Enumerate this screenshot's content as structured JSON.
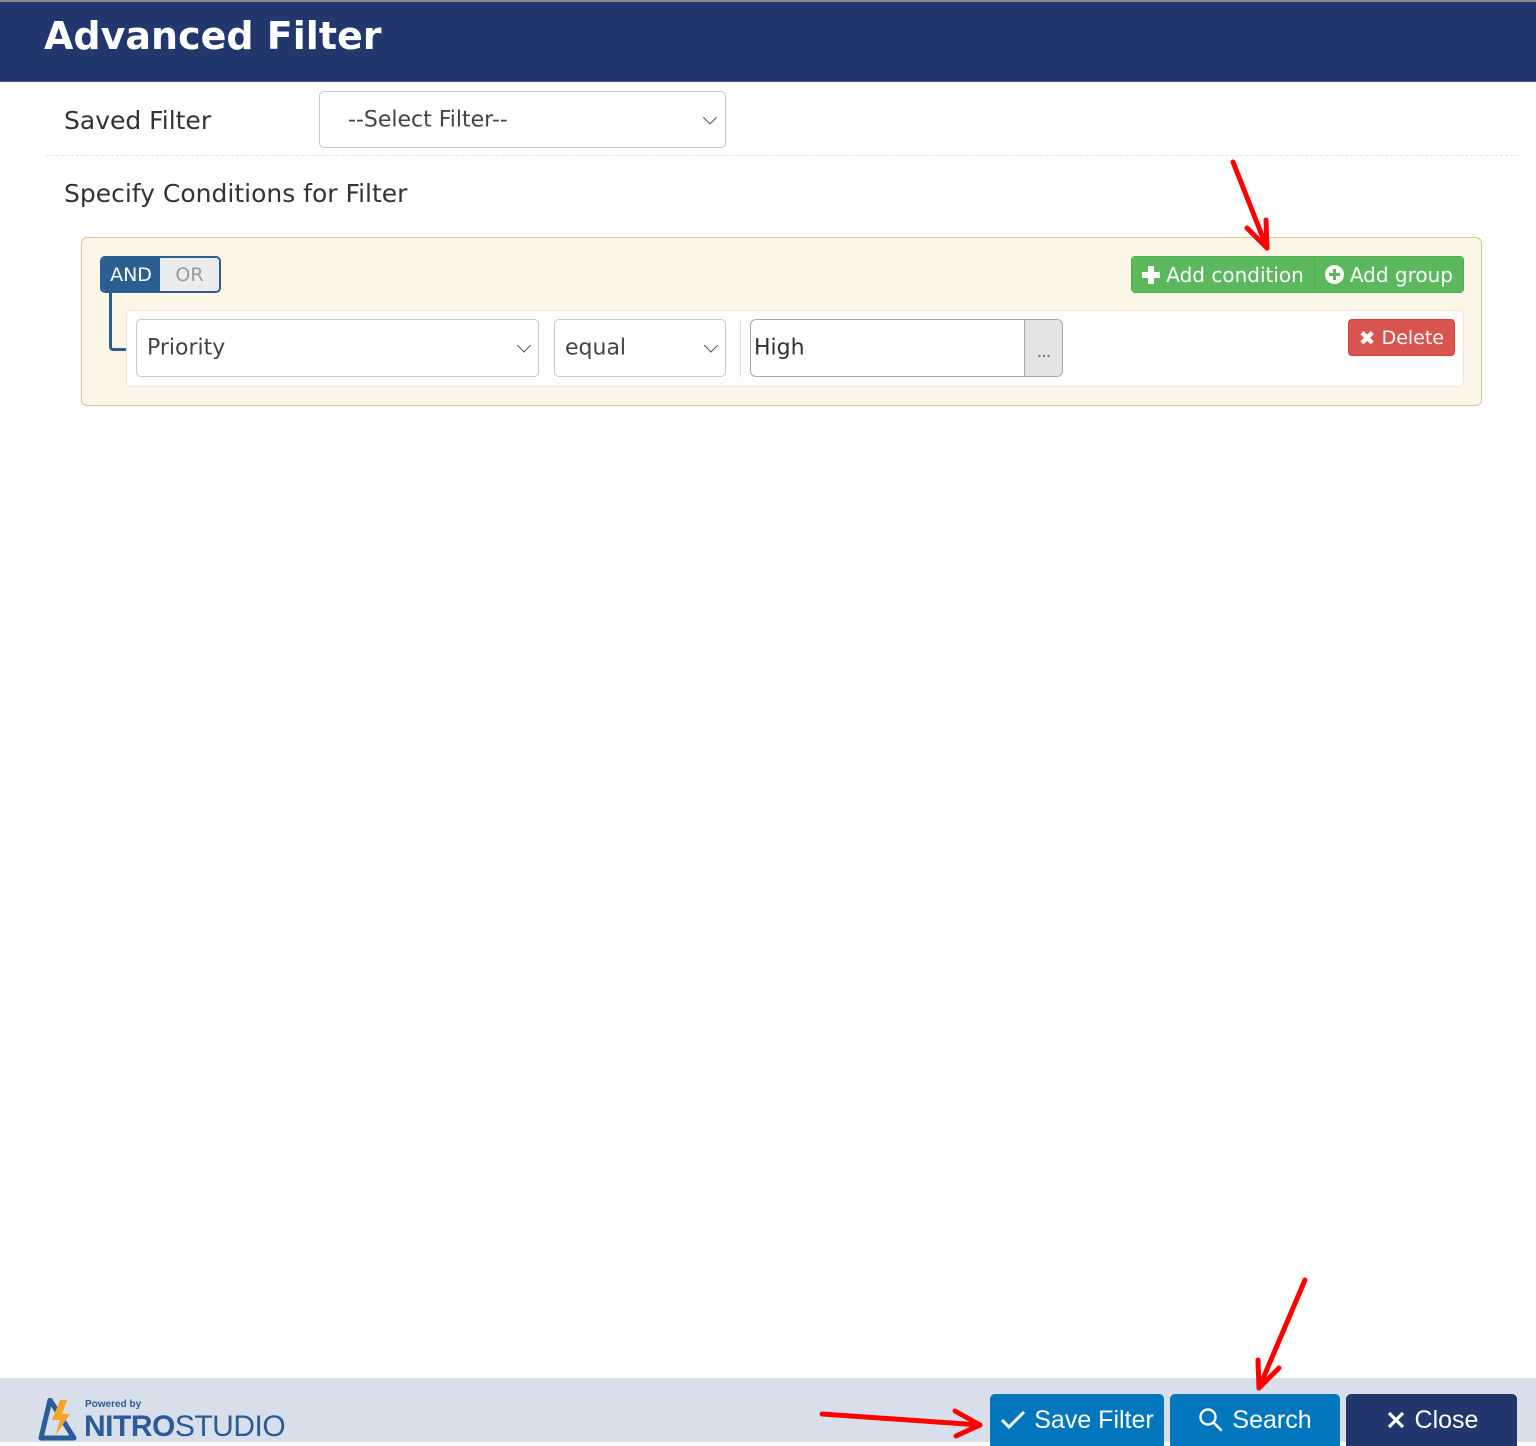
{
  "header": {
    "title": "Advanced Filter"
  },
  "saved_filter": {
    "label": "Saved Filter",
    "selected": "--Select Filter--"
  },
  "conditions": {
    "heading": "Specify Conditions for Filter",
    "group": {
      "logic_options": [
        "AND",
        "OR"
      ],
      "active_logic": "AND",
      "add_condition_label": "Add condition",
      "add_group_label": "Add group",
      "rules": [
        {
          "field": "Priority",
          "operator": "equal",
          "value": "High",
          "more_label": "...",
          "delete_label": "Delete"
        }
      ]
    }
  },
  "footer": {
    "logo": {
      "powered_by": "Powered by",
      "brand_bold": "NITRO",
      "brand_light": "STUDIO"
    },
    "buttons": {
      "save_filter": "Save Filter",
      "search": "Search",
      "close": "Close"
    }
  },
  "annotations": {
    "arrow_color": "#ff0000"
  },
  "colors": {
    "header_bg": "#21376d",
    "primary_blue": "#0277bd",
    "success_green": "#5cb85c",
    "danger_red": "#d9534f",
    "logic_blue": "#2b5f91"
  }
}
